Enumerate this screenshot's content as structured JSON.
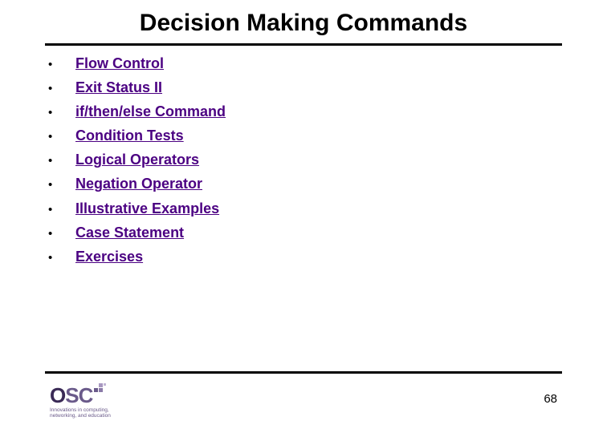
{
  "title": "Decision Making Commands",
  "items": [
    "Flow Control",
    "Exit Status II",
    "if/then/else Command",
    "Condition Tests",
    "Logical Operators",
    "Negation Operator",
    "Illustrative Examples",
    "Case Statement",
    "Exercises"
  ],
  "logo": {
    "letters": {
      "o": "O",
      "s": "S",
      "c": "C"
    },
    "tagline_line1": "Innovations in computing,",
    "tagline_line2": "networking, and education"
  },
  "page_number": "68"
}
